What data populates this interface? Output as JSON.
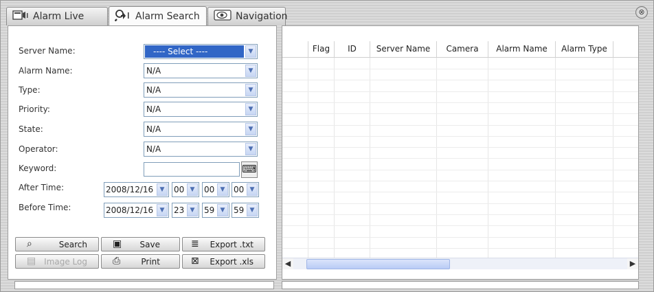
{
  "tabs": [
    {
      "label": "Alarm Live",
      "icon": "video-icon"
    },
    {
      "label": "Alarm Search",
      "icon": "search-icon"
    },
    {
      "label": "Navigation",
      "icon": "eye-icon"
    }
  ],
  "close_symbol": "⊗",
  "form": {
    "server_name": {
      "label": "Server Name:",
      "value": "---- Select ----"
    },
    "alarm_name": {
      "label": "Alarm Name:",
      "value": "N/A"
    },
    "type": {
      "label": "Type:",
      "value": "N/A"
    },
    "priority": {
      "label": "Priority:",
      "value": "N/A"
    },
    "state": {
      "label": "State:",
      "value": "N/A"
    },
    "operator": {
      "label": "Operator:",
      "value": "N/A"
    },
    "keyword": {
      "label": "Keyword:",
      "value": ""
    },
    "after_time": {
      "label": "After Time:",
      "date": "2008/12/16",
      "hh": "00",
      "mm": "00",
      "ss": "00"
    },
    "before_time": {
      "label": "Before Time:",
      "date": "2008/12/16",
      "hh": "23",
      "mm": "59",
      "ss": "59"
    }
  },
  "buttons": {
    "search": "Search",
    "save": "Save",
    "export_txt": "Export .txt",
    "image_log": "Image Log",
    "print": "Print",
    "export_xls": "Export .xls"
  },
  "grid": {
    "columns": [
      "Flag",
      "ID",
      "Server Name",
      "Camera",
      "Alarm Name",
      "Alarm Type"
    ]
  }
}
